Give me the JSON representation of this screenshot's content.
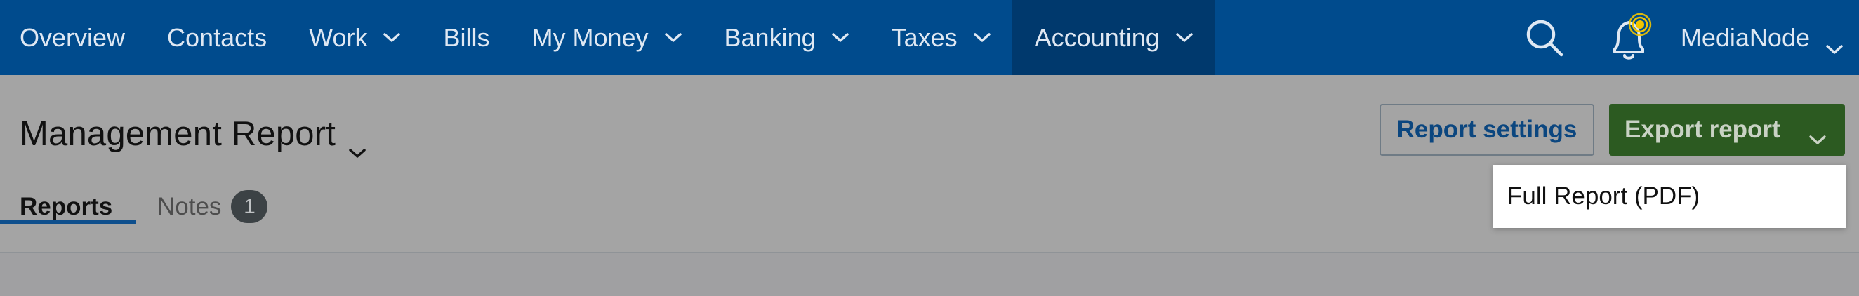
{
  "nav": {
    "items": [
      {
        "label": "Overview",
        "has_menu": false
      },
      {
        "label": "Contacts",
        "has_menu": false
      },
      {
        "label": "Work",
        "has_menu": true
      },
      {
        "label": "Bills",
        "has_menu": false
      },
      {
        "label": "My Money",
        "has_menu": true
      },
      {
        "label": "Banking",
        "has_menu": true
      },
      {
        "label": "Taxes",
        "has_menu": true
      },
      {
        "label": "Accounting",
        "has_menu": true,
        "active": true
      }
    ],
    "search_icon": "search-icon",
    "notification_icon": "bell-icon",
    "account_name": "MediaNode",
    "colors": {
      "nav_bg": "#004b8d",
      "active_bg": "#00396d",
      "notification_dot": "#f0c400"
    }
  },
  "page": {
    "title": "Management Report",
    "report_settings_label": "Report settings",
    "export_label": "Export report",
    "export_menu": {
      "items": [
        "Full Report (PDF)"
      ]
    },
    "tabs": [
      {
        "label": "Reports",
        "active": true
      },
      {
        "label": "Notes",
        "badge": "1"
      }
    ],
    "colors": {
      "export_bg": "#2c5a21",
      "link": "#0b467f",
      "tab_underline": "#0e4f8d"
    }
  }
}
